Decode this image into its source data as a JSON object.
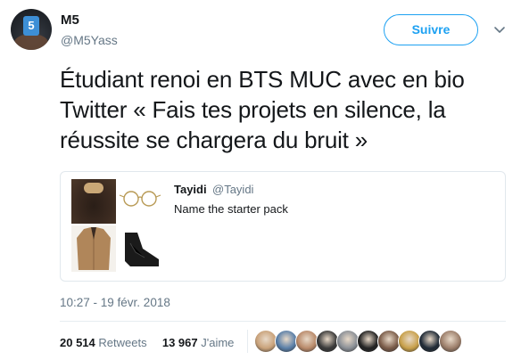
{
  "tweet": {
    "author_name": "M5",
    "author_handle": "@M5Yass",
    "follow_label": "Suivre",
    "text": "Étudiant renoi en BTS MUC avec en bio Twitter « Fais tes projets en silence, la réussite se chargera du bruit »",
    "timestamp": "10:27 - 19 févr. 2018"
  },
  "quoted": {
    "author_name": "Tayidi",
    "author_handle": "@Tayidi",
    "text": "Name the starter pack"
  },
  "stats": {
    "retweets_count": "20 514",
    "retweets_label": "Retweets",
    "likes_count": "13 967",
    "likes_label": "J'aime"
  },
  "colors": {
    "accent": "#1da1f2",
    "muted": "#657786",
    "text": "#14171a"
  },
  "likers": [
    {
      "name": "liker-avatar",
      "color": "#c9a27a"
    },
    {
      "name": "liker-avatar",
      "color": "#5a7fa8"
    },
    {
      "name": "liker-avatar",
      "color": "#b98a6a"
    },
    {
      "name": "liker-avatar",
      "color": "#3a3a3a"
    },
    {
      "name": "liker-avatar",
      "color": "#8a8f96"
    },
    {
      "name": "liker-avatar",
      "color": "#222222"
    },
    {
      "name": "liker-avatar",
      "color": "#7b5c49"
    },
    {
      "name": "liker-avatar",
      "color": "#c8a04a"
    },
    {
      "name": "liker-avatar",
      "color": "#1f2a36"
    },
    {
      "name": "liker-avatar",
      "color": "#9c7e6a"
    }
  ]
}
